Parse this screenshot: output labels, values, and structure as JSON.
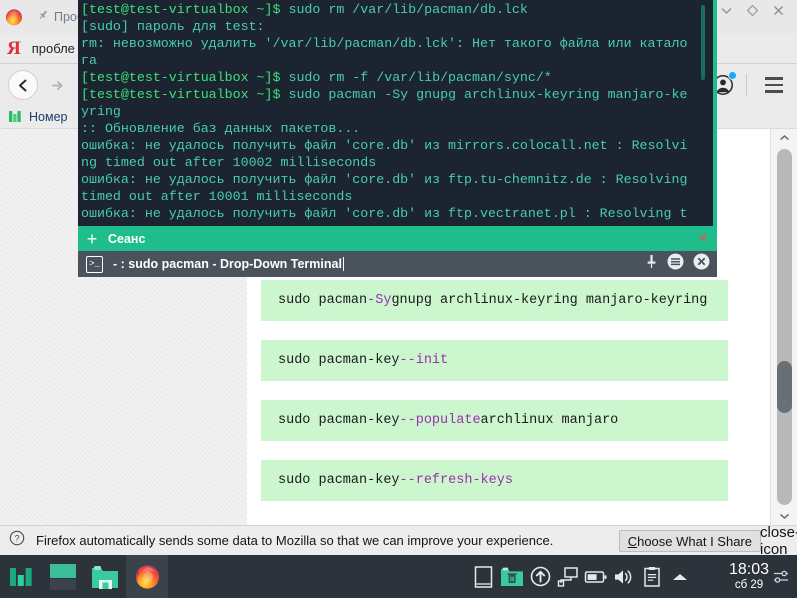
{
  "browser": {
    "pinned_tab": {
      "label": "Проб",
      "icon": "pin-icon"
    },
    "window_controls": {
      "minimize": "chevron-down-icon",
      "maximize": "diamond-icon",
      "close": "close-icon"
    },
    "search_bar": {
      "engine_logo": "Я",
      "query": "пробле"
    },
    "nav": {
      "back": "back-arrow-icon",
      "forward": "forward-arrow-icon",
      "reload": "reload-icon"
    },
    "account": {
      "icon": "account-avatar-icon",
      "badge": true
    },
    "menu": "hamburger-menu-icon",
    "bookmarks": [
      {
        "label": "Номер",
        "icon": "bookmark-green-icon"
      }
    ]
  },
  "page": {
    "code_blocks": [
      {
        "cmd": "sudo pacman ",
        "flag": "-Sy",
        "rest": " gnupg archlinux-keyring manjaro-keyring"
      },
      {
        "cmd": "sudo pacman-key ",
        "flag": "--init",
        "rest": ""
      },
      {
        "cmd": "sudo pacman-key ",
        "flag": "--populate",
        "rest": " archlinux manjaro"
      },
      {
        "cmd": "sudo pacman-key ",
        "flag": "--refresh-keys",
        "rest": ""
      }
    ],
    "scrollbar": {
      "up": "chevron-up-icon",
      "down": "chevron-down-icon"
    }
  },
  "notification": {
    "icon": "question-mark-icon",
    "message": "Firefox automatically sends some data to Mozilla so that we can improve your experience.",
    "button_prefix": "C",
    "button_rest": "hoose What I Share",
    "close": "close-icon"
  },
  "terminal": {
    "title": "- : sudo pacman - Drop-Down Terminal",
    "icon": ">_",
    "tab_label": "Сеанс",
    "new_tab": "+",
    "tab_close": "×",
    "buttons": {
      "pin": "pin-icon",
      "menu": "menu-circle-icon",
      "close": "close-circle-icon"
    },
    "lines": [
      {
        "type": "prompt",
        "text": "[test@test-virtualbox ~]$ ",
        "cmd": "sudo rm /var/lib/pacman/db.lck"
      },
      {
        "type": "out",
        "text": "[sudo] пароль для test:"
      },
      {
        "type": "out",
        "text": "rm: невозможно удалить '/var/lib/pacman/db.lck': Нет такого файла или каталога"
      },
      {
        "type": "prompt",
        "text": "[test@test-virtualbox ~]$ ",
        "cmd": "sudo rm -f /var/lib/pacman/sync/*"
      },
      {
        "type": "prompt",
        "text": "[test@test-virtualbox ~]$ ",
        "cmd": "sudo pacman -Sy gnupg archlinux-keyring manjaro-keyring"
      },
      {
        "type": "out",
        "text": ":: Обновление баз данных пакетов..."
      },
      {
        "type": "out",
        "text": "ошибка: не удалось получить файл 'core.db' из mirrors.colocall.net : Resolving timed out after 10002 milliseconds"
      },
      {
        "type": "out",
        "text": "ошибка: не удалось получить файл 'core.db' из ftp.tu-chemnitz.de : Resolving timed out after 10001 milliseconds"
      },
      {
        "type": "out",
        "text": "ошибка: не удалось получить файл 'core.db' из ftp.vectranet.pl : Resolving t"
      }
    ]
  },
  "taskbar": {
    "launchers": [
      {
        "name": "manjaro-menu-icon"
      },
      {
        "name": "show-desktop-icon"
      },
      {
        "name": "file-manager-icon"
      },
      {
        "name": "firefox-icon",
        "active": true
      }
    ],
    "tray": [
      {
        "name": "window-list-icon"
      },
      {
        "name": "trash-icon"
      },
      {
        "name": "updates-icon"
      },
      {
        "name": "network-icon"
      },
      {
        "name": "battery-icon"
      },
      {
        "name": "volume-icon"
      },
      {
        "name": "clipboard-icon"
      },
      {
        "name": "show-hidden-icon"
      }
    ],
    "clock": {
      "time": "18:03",
      "date": "сб 29"
    },
    "settings_icon": "sliders-icon"
  },
  "colors": {
    "accent_teal": "#20bd8c",
    "terminal_bg": "#1b2430",
    "terminal_green": "#3ee07a",
    "code_bg": "#ccf7ce",
    "flag_purple": "#9b2fae",
    "taskbar": "#2d333b"
  }
}
